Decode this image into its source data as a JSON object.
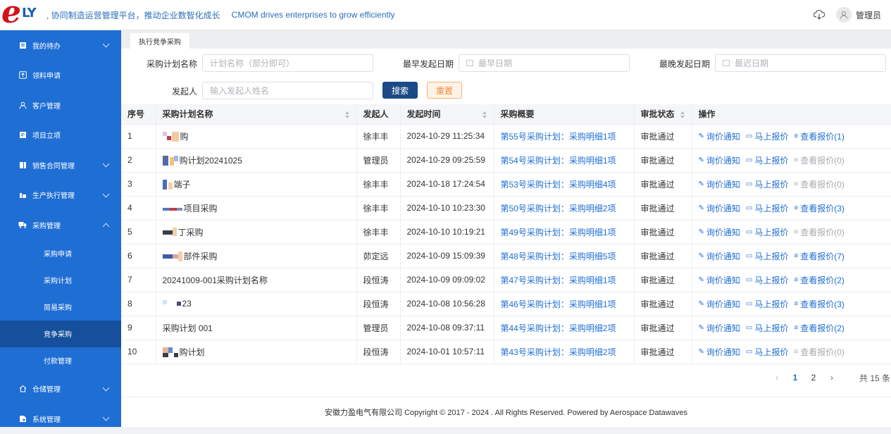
{
  "header": {
    "logo_text_e": "e",
    "logo_text_ly": "LY",
    "slogan_cn": ", 协同制造运营管理平台，推动企业数智化成长",
    "slogan_en": "CMOM drives enterprises to grow efficiently",
    "user_name": "管理员"
  },
  "sidebar": {
    "items": [
      {
        "label": "我的待办",
        "icon": "todo-icon",
        "chevron": "down"
      },
      {
        "label": "领料申请",
        "icon": "upload-icon",
        "chevron": ""
      },
      {
        "label": "客户管理",
        "icon": "user-icon",
        "chevron": ""
      },
      {
        "label": "项目立项",
        "icon": "doc-icon",
        "chevron": ""
      },
      {
        "label": "销售合同管理",
        "icon": "contract-icon",
        "chevron": "down"
      },
      {
        "label": "生产执行管理",
        "icon": "factory-icon",
        "chevron": "down"
      },
      {
        "label": "采购管理",
        "icon": "truck-icon",
        "chevron": "up"
      }
    ],
    "sub_items": [
      "采购申请",
      "采购计划",
      "简易采购",
      "竞争采购",
      "付款管理"
    ],
    "active_sub": "竞争采购",
    "bottom_items": [
      {
        "label": "仓储管理",
        "icon": "home-icon",
        "chevron": "down"
      },
      {
        "label": "系统管理",
        "icon": "settings-icon",
        "chevron": "down"
      }
    ]
  },
  "tabs": {
    "active": "执行竞争采购"
  },
  "filters": {
    "plan_name_label": "采购计划名称",
    "plan_name_placeholder": "计划名称（部分即可）",
    "earliest_label": "最早发起日期",
    "earliest_placeholder": "最早日期",
    "latest_label": "最晚发起日期",
    "latest_placeholder": "最迟日期",
    "initiator_label": "发起人",
    "initiator_placeholder": "输入发起人姓名",
    "search_label": "搜索",
    "reset_label": "重置"
  },
  "table": {
    "columns": [
      "序号",
      "采购计划名称",
      "发起人",
      "发起时间",
      "采购概要",
      "审批状态",
      "操作"
    ],
    "actions": {
      "inquiry": "询价通知",
      "quote": "马上报价",
      "view_prefix": "查看报价"
    },
    "rows": [
      {
        "no": "1",
        "name": "购",
        "initiator": "徐丰丰",
        "time": "2024-10-29 11:25:34",
        "summary": "第55号采购计划：采购明细1项",
        "status": "审批通过",
        "view": "查看报价(1)",
        "view_enabled": true
      },
      {
        "no": "2",
        "name": "购计划20241025",
        "initiator": "管理员",
        "time": "2024-10-29 09:25:59",
        "summary": "第54号采购计划：采购明细1项",
        "status": "审批通过",
        "view": "查看报价(0)",
        "view_enabled": false
      },
      {
        "no": "3",
        "name": "端子",
        "initiator": "徐丰丰",
        "time": "2024-10-18 17:24:54",
        "summary": "第53号采购计划：采购明细4项",
        "status": "审批通过",
        "view": "查看报价(0)",
        "view_enabled": false
      },
      {
        "no": "4",
        "name": "项目采购",
        "initiator": "徐丰丰",
        "time": "2024-10-10 10:23:30",
        "summary": "第50号采购计划：采购明细2项",
        "status": "审批通过",
        "view": "查看报价(3)",
        "view_enabled": true
      },
      {
        "no": "5",
        "name": "丁采购",
        "initiator": "徐丰丰",
        "time": "2024-10-10 10:19:21",
        "summary": "第49号采购计划：采购明细1项",
        "status": "审批通过",
        "view": "查看报价(0)",
        "view_enabled": false
      },
      {
        "no": "6",
        "name": "部件采购",
        "initiator": "茆定远",
        "time": "2024-10-09 15:09:39",
        "summary": "第48号采购计划：采购明细5项",
        "status": "审批通过",
        "view": "查看报价(7)",
        "view_enabled": true
      },
      {
        "no": "7",
        "name": "20241009-001采购计划名称",
        "initiator": "段恒涛",
        "time": "2024-10-09 09:09:02",
        "summary": "第47号采购计划：采购明细1项",
        "status": "审批通过",
        "view": "查看报价(2)",
        "view_enabled": true
      },
      {
        "no": "8",
        "name": "23",
        "initiator": "段恒涛",
        "time": "2024-10-08 10:56:28",
        "summary": "第46号采购计划：采购明细1项",
        "status": "审批通过",
        "view": "查看报价(3)",
        "view_enabled": true
      },
      {
        "no": "9",
        "name": "采购计划 001",
        "initiator": "管理员",
        "time": "2024-10-08 09:37:11",
        "summary": "第44号采购计划：采购明细2项",
        "status": "审批通过",
        "view": "查看报价(2)",
        "view_enabled": true
      },
      {
        "no": "10",
        "name": "购计划",
        "initiator": "段恒涛",
        "time": "2024-10-01 10:57:11",
        "summary": "第43号采购计划：采购明细2项",
        "status": "审批通过",
        "view": "查看报价(0)",
        "view_enabled": false
      }
    ]
  },
  "pagination": {
    "prev": "‹",
    "pages": [
      "1",
      "2"
    ],
    "current": "1",
    "next": "›",
    "total": "共 15 条"
  },
  "footer": {
    "copyright": "安徽力盈电气有限公司 Copyright © 2017 - 2024 . All Rights Reserved. Powered by Aerospace Datawaves"
  },
  "colors": {
    "primary": "#1f6ed4",
    "sidebar_active": "#164f9c",
    "logo_red": "#d4111a",
    "search_btn": "#1b4a86",
    "reset_btn": "#f08c3a"
  }
}
